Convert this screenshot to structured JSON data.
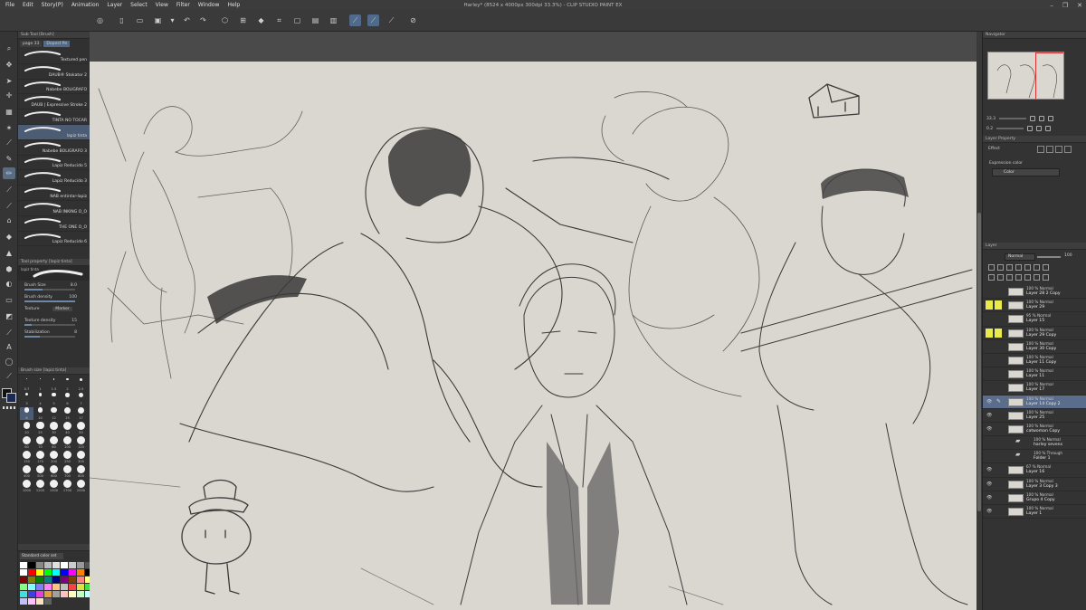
{
  "app": {
    "title": "Harley* (8524 x 4000px 300dpi 33.3%) - CLIP STUDIO PAINT EX",
    "menu": [
      "File",
      "Edit",
      "Story(P)",
      "Animation",
      "Layer",
      "Select",
      "View",
      "Filter",
      "Window",
      "Help"
    ],
    "window_controls": [
      "–",
      "❐",
      "✕"
    ]
  },
  "subtool": {
    "header": "Sub Tool [Brush]",
    "tabs": [
      "page 33",
      "Dopest Pe"
    ],
    "brushes": [
      "Textured pen",
      "DAUB® Stokator 2",
      "Nabebe BOLIGRAFO",
      "DAUB | Expressive Stroke 2",
      "TINTA NO TOCAR",
      "lapiz tinta",
      "Nabebe BOLIGRAFO 3",
      "Lapiz Reducido 5",
      "Lapiz Reducido 3",
      "NAB entintar-lapiz",
      "NAB INKING O_O",
      "THE ONE O_O",
      "Lapiz Reducido 6"
    ],
    "selected_index": 5
  },
  "tool_property": {
    "header": "Tool property [lapiz tinta]",
    "name": "lapiz tinta",
    "brush_size": {
      "label": "Brush Size",
      "value": "8.0",
      "fill": 0.35
    },
    "brush_density": {
      "label": "Brush density",
      "value": "100",
      "fill": 1.0
    },
    "texture": {
      "label": "Texture",
      "value": "Marker"
    },
    "texture_density": {
      "label": "Texture density",
      "value": "15",
      "fill": 0.15
    },
    "stabilization": {
      "label": "Stabilization",
      "value": "8",
      "fill": 0.3
    }
  },
  "brush_size_panel": {
    "header": "Brush size [lapiz tinta]",
    "sizes": [
      "0.7",
      "1",
      "1.5",
      "2",
      "2.5",
      "3",
      "4",
      "5",
      "6",
      "7",
      "8",
      "10",
      "12",
      "15",
      "17",
      "20",
      "25",
      "30",
      "40",
      "50",
      "60",
      "70",
      "80",
      "100",
      "120",
      "150",
      "170",
      "200",
      "250",
      "300",
      "400",
      "500",
      "600",
      "700",
      "800",
      "1000",
      "1200",
      "1500",
      "1700",
      "2000"
    ],
    "selected": "8"
  },
  "color_set": {
    "header": "Standard color set",
    "swatches": [
      "#ffffff",
      "#000000",
      "#888888",
      "#bbbbbb",
      "#e0e0e0",
      "#ffffff",
      "#cccccc",
      "#999999",
      "#555555",
      "#ffffff",
      "#ff0000",
      "#ffff00",
      "#00ff00",
      "#00ffff",
      "#0000ff",
      "#ff00ff",
      "#ff8000",
      "#000000",
      "#800000",
      "#808000",
      "#008000",
      "#008080",
      "#000080",
      "#800080",
      "#804000",
      "#ff8080",
      "#ffff80",
      "#80ff80",
      "#80ffff",
      "#8080ff",
      "#ff80ff",
      "#ffc080",
      "#c0c0c0",
      "#ff4040",
      "#e0e040",
      "#40e040",
      "#40e0e0",
      "#4040e0",
      "#e040e0",
      "#e0a040",
      "#a0a0a0",
      "#ffc0c0",
      "#ffffc0",
      "#c0ffc0",
      "#c0ffff",
      "#c0c0ff",
      "#ffc0ff",
      "#ffe0c0",
      "#606060"
    ]
  },
  "navigator": {
    "header": "Navigator",
    "zoom": "33.3",
    "angle": "0.2"
  },
  "layer_property": {
    "header": "Layer Property",
    "effect_label": "Effect",
    "expression_color_label": "Expression color",
    "expression_color_value": "Color"
  },
  "layers_panel": {
    "header": "Layer",
    "blend_mode": "Normal",
    "opacity": "100",
    "layers": [
      {
        "line1": "100 % Normal",
        "line2": "Layer 28 2 Copy",
        "visible": false,
        "marks": 0,
        "selected": false,
        "folder": false
      },
      {
        "line1": "100 % Normal",
        "line2": "Layer 29",
        "visible": false,
        "marks": 2,
        "selected": false,
        "folder": false
      },
      {
        "line1": "95 % Normal",
        "line2": "Layer 15",
        "visible": false,
        "marks": 0,
        "selected": false,
        "folder": false
      },
      {
        "line1": "100 % Normal",
        "line2": "Layer 29 Copy",
        "visible": false,
        "marks": 2,
        "selected": false,
        "folder": false
      },
      {
        "line1": "100 % Normal",
        "line2": "Layer 30 Copy",
        "visible": false,
        "marks": 0,
        "selected": false,
        "folder": false
      },
      {
        "line1": "100 % Normal",
        "line2": "Layer 11 Copy",
        "visible": false,
        "marks": 0,
        "selected": false,
        "folder": false
      },
      {
        "line1": "100 % Normal",
        "line2": "Layer 11",
        "visible": false,
        "marks": 0,
        "selected": false,
        "folder": false
      },
      {
        "line1": "100 % Normal",
        "line2": "Layer 17",
        "visible": false,
        "marks": 0,
        "selected": false,
        "folder": false
      },
      {
        "line1": "100 % Normal",
        "line2": "Layer 14 Copy 2",
        "visible": true,
        "marks": 0,
        "selected": true,
        "folder": false
      },
      {
        "line1": "100 % Normal",
        "line2": "Layer 25",
        "visible": true,
        "marks": 0,
        "selected": false,
        "folder": false
      },
      {
        "line1": "100 % Normal",
        "line2": "catwoman Copy",
        "visible": true,
        "marks": 0,
        "selected": false,
        "folder": false
      },
      {
        "line1": "100 % Normal",
        "line2": "harley sevens",
        "visible": false,
        "marks": 0,
        "selected": false,
        "folder": true
      },
      {
        "line1": "100 % Through",
        "line2": "Folder 1",
        "visible": false,
        "marks": 0,
        "selected": false,
        "folder": true
      },
      {
        "line1": "67 % Normal",
        "line2": "Layer 16",
        "visible": true,
        "marks": 0,
        "selected": false,
        "folder": false
      },
      {
        "line1": "100 % Normal",
        "line2": "Layer 3 Copy 3",
        "visible": true,
        "marks": 0,
        "selected": false,
        "folder": false
      },
      {
        "line1": "100 % Normal",
        "line2": "Grupo 4 Copy",
        "visible": true,
        "marks": 0,
        "selected": false,
        "folder": false
      },
      {
        "line1": "100 % Normal",
        "line2": "Layer 1",
        "visible": true,
        "marks": 0,
        "selected": false,
        "folder": false
      }
    ]
  },
  "colors": {
    "paper": "#d9d7cf",
    "accent": "#5a6d8c",
    "mark": "#e9ea4b"
  }
}
